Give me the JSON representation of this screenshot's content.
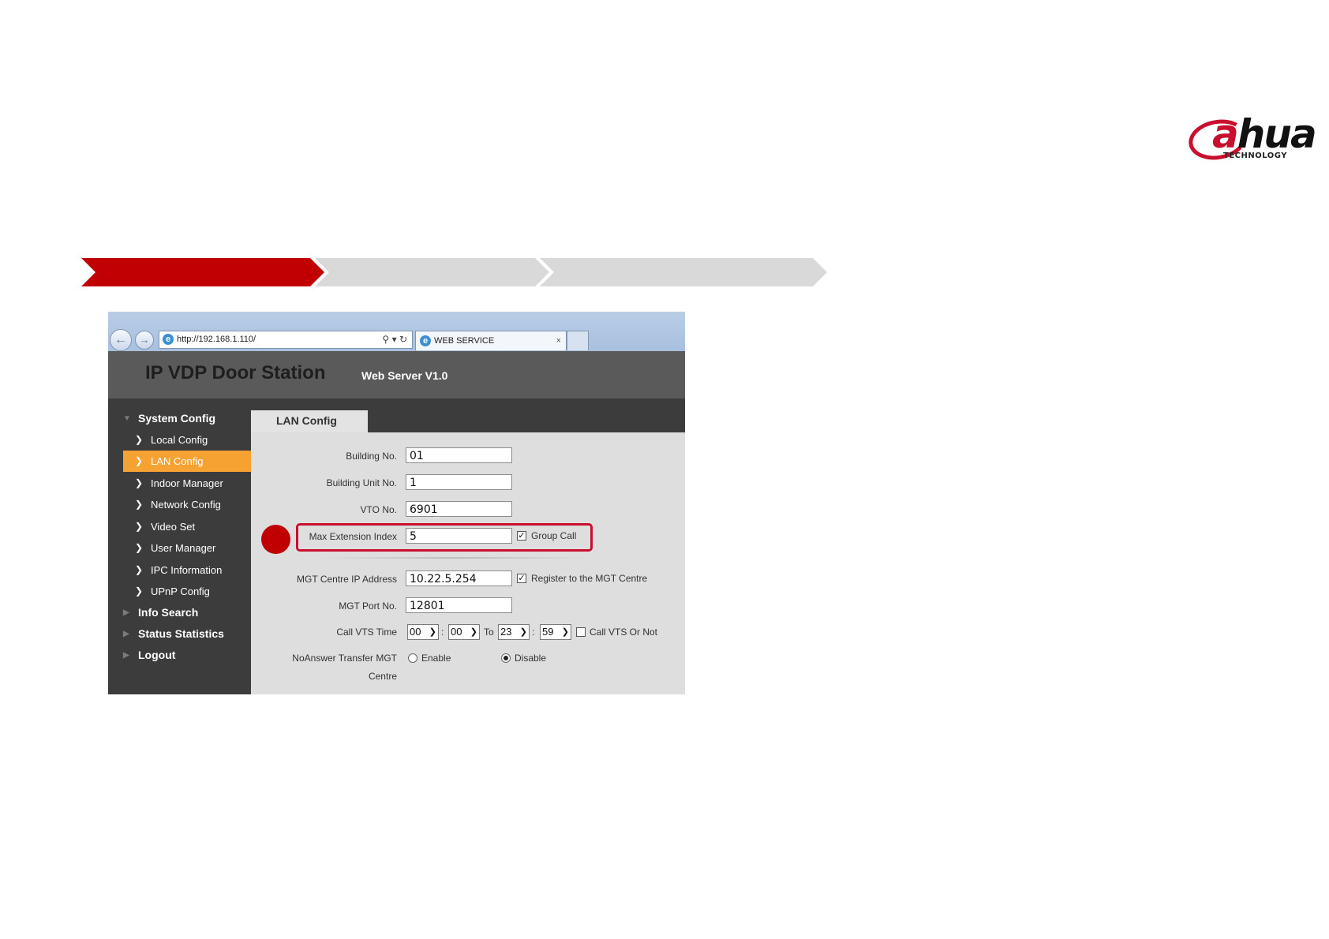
{
  "logo": {
    "part1": "a",
    "part2": "hua",
    "tagline": "TECHNOLOGY",
    "brand_color": "#c8102e"
  },
  "steps": {
    "active_color": "#c00000",
    "inactive_color": "#d9d9d9"
  },
  "browser": {
    "url": "http://192.168.1.110/",
    "tab_title": "WEB SERVICE",
    "back_icon": "back-arrow-icon",
    "forward_icon": "forward-arrow-icon"
  },
  "app": {
    "title": "IP VDP Door Station",
    "subtitle": "Web Server V1.0"
  },
  "sidebar": {
    "groups": [
      {
        "label": "System Config",
        "expanded": true
      },
      {
        "label": "Info Search"
      },
      {
        "label": "Status Statistics"
      },
      {
        "label": "Logout"
      }
    ],
    "items": [
      {
        "label": "Local Config"
      },
      {
        "label": "LAN Config",
        "active": true
      },
      {
        "label": "Indoor Manager"
      },
      {
        "label": "Network Config"
      },
      {
        "label": "Video Set"
      },
      {
        "label": "User Manager"
      },
      {
        "label": "IPC Information"
      },
      {
        "label": "UPnP Config"
      }
    ],
    "active_color": "#f6a233"
  },
  "page": {
    "tab": "LAN Config"
  },
  "form": {
    "building_no": {
      "label": "Building No.",
      "value": "01"
    },
    "building_unit_no": {
      "label": "Building Unit No.",
      "value": "1"
    },
    "vto_no": {
      "label": "VTO No.",
      "value": "6901"
    },
    "max_extension_index": {
      "label": "Max Extension Index",
      "value": "5"
    },
    "group_call": {
      "label": "Group Call",
      "checked": true,
      "mark": "✓"
    },
    "mgt_ip": {
      "label": "MGT Centre IP Address",
      "value": "10.22.5.254"
    },
    "register_mgt": {
      "label": "Register to the MGT Centre",
      "checked": true,
      "mark": "✓"
    },
    "mgt_port": {
      "label": "MGT Port No.",
      "value": "12801"
    },
    "call_vts_time": {
      "label": "Call VTS Time",
      "start_hour": "00",
      "start_min": "00",
      "to": "To",
      "end_hour": "23",
      "end_min": "59",
      "colon": ":"
    },
    "call_vts_or_not": {
      "label": "Call VTS Or Not",
      "checked": false
    },
    "noanswer": {
      "label_line1": "NoAnswer Transfer MGT",
      "label_line2": "Centre",
      "enable": "Enable",
      "disable": "Disable",
      "selected": "Disable"
    }
  },
  "highlight_color": "#c8102e"
}
